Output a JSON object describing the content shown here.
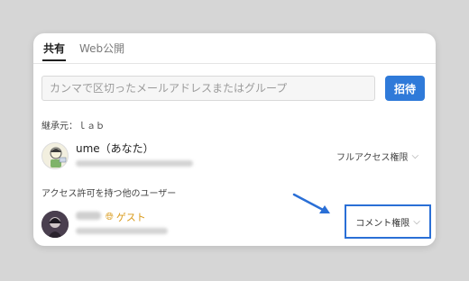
{
  "tabs": [
    {
      "label": "共有",
      "active": true
    },
    {
      "label": "Web公開",
      "active": false
    }
  ],
  "invite": {
    "placeholder": "カンマで区切ったメールアドレスまたはグループ",
    "button_label": "招待"
  },
  "inherited": {
    "label": "継承元：ｌａｂ"
  },
  "owner": {
    "name": "ume（あなた）",
    "permission": "フルアクセス権限"
  },
  "others_section": {
    "title": "アクセス許可を持つ他のユーザー"
  },
  "guest": {
    "badge": "ゲスト",
    "permission": "コメント権限"
  },
  "colors": {
    "accent": "#2f7ad9",
    "highlight_border": "#2a6fd6",
    "guest_badge": "#d99a1a"
  },
  "icons": {
    "chevron": "chevron-down-icon",
    "globe": "globe-icon",
    "arrow": "annotation-arrow"
  }
}
